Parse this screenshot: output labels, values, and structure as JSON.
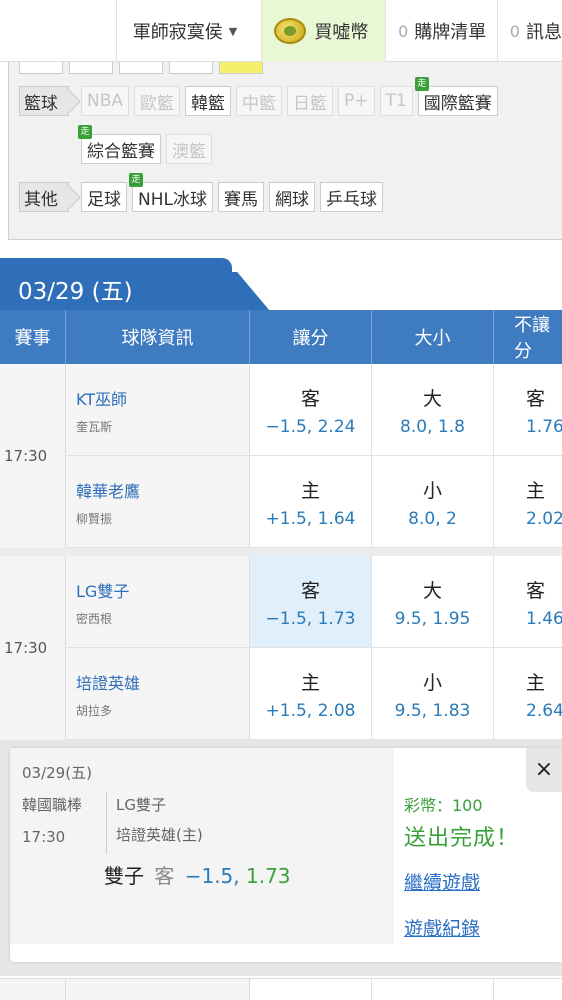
{
  "topbar": {
    "user": "軍師寂寞侯",
    "buy": "買噓幣",
    "watch_count": "0",
    "watch": "購牌清單",
    "msg_count": "0",
    "msg": "訊息"
  },
  "filter": {
    "basketball": {
      "label": "籃球",
      "chips": [
        {
          "text": "NBA",
          "state": "off"
        },
        {
          "text": "歐籃",
          "state": "off"
        },
        {
          "text": "韓籃",
          "state": "on"
        },
        {
          "text": "中籃",
          "state": "off"
        },
        {
          "text": "日籃",
          "state": "off"
        },
        {
          "text": "P+",
          "state": "off"
        },
        {
          "text": "T1",
          "state": "off"
        },
        {
          "text": "國際籃賽",
          "state": "on",
          "live": "走"
        },
        {
          "text": "綜合籃賽",
          "state": "on",
          "live": "走"
        },
        {
          "text": "澳籃",
          "state": "off"
        }
      ]
    },
    "other": {
      "label": "其他",
      "chips": [
        {
          "text": "足球",
          "state": "on"
        },
        {
          "text": "NHL冰球",
          "state": "on",
          "live": "走"
        },
        {
          "text": "賽馬",
          "state": "on"
        },
        {
          "text": "網球",
          "state": "on"
        },
        {
          "text": "乒乓球",
          "state": "on"
        }
      ]
    }
  },
  "date_tab": "03/29 (五)",
  "table_headers": [
    "賽事",
    "球隊資訊",
    "讓分",
    "大小",
    "不讓分"
  ],
  "games": [
    {
      "time": "17:30",
      "rows": [
        {
          "team": "KT巫師",
          "pitcher": "奎瓦斯",
          "spread_side": "客",
          "spread": "−1.5, 2.24",
          "ou_side": "大",
          "ou": "8.0, 1.8",
          "ml_side": "客",
          "ml": "1.76"
        },
        {
          "team": "韓華老鷹",
          "pitcher": "柳賢振",
          "spread_side": "主",
          "spread": "+1.5, 1.64",
          "ou_side": "小",
          "ou": "8.0, 2",
          "ml_side": "主",
          "ml": "2.02"
        }
      ]
    },
    {
      "time": "17:30",
      "rows": [
        {
          "team": "LG雙子",
          "pitcher": "密西根",
          "spread_side": "客",
          "spread": "−1.5, 1.73",
          "ou_side": "大",
          "ou": "9.5, 1.95",
          "ml_side": "客",
          "ml": "1.46",
          "selected": true
        },
        {
          "team": "培證英雄",
          "pitcher": "胡拉多",
          "spread_side": "主",
          "spread": "+1.5, 2.08",
          "ou_side": "小",
          "ou": "9.5, 1.83",
          "ml_side": "主",
          "ml": "2.64"
        }
      ]
    }
  ],
  "slip": {
    "date": "03/29(五)",
    "league": "韓國職棒",
    "time": "17:30",
    "team_away": "LG雙子",
    "team_home": "培證英雄(主)",
    "pick_team": "雙子",
    "pick_side": "客",
    "pick_line": "−1.5,",
    "pick_odds": "1.73",
    "coin_text": "彩幣：100",
    "done_text": "送出完成！",
    "continue_link": "繼續遊戲",
    "history_link": "遊戲紀錄",
    "close": "×"
  },
  "colors": {
    "header_blue": "#3f7bc1",
    "link_blue": "#2a7bb9",
    "success_green": "#3aa03a",
    "selected_cell": "#e1effb"
  }
}
